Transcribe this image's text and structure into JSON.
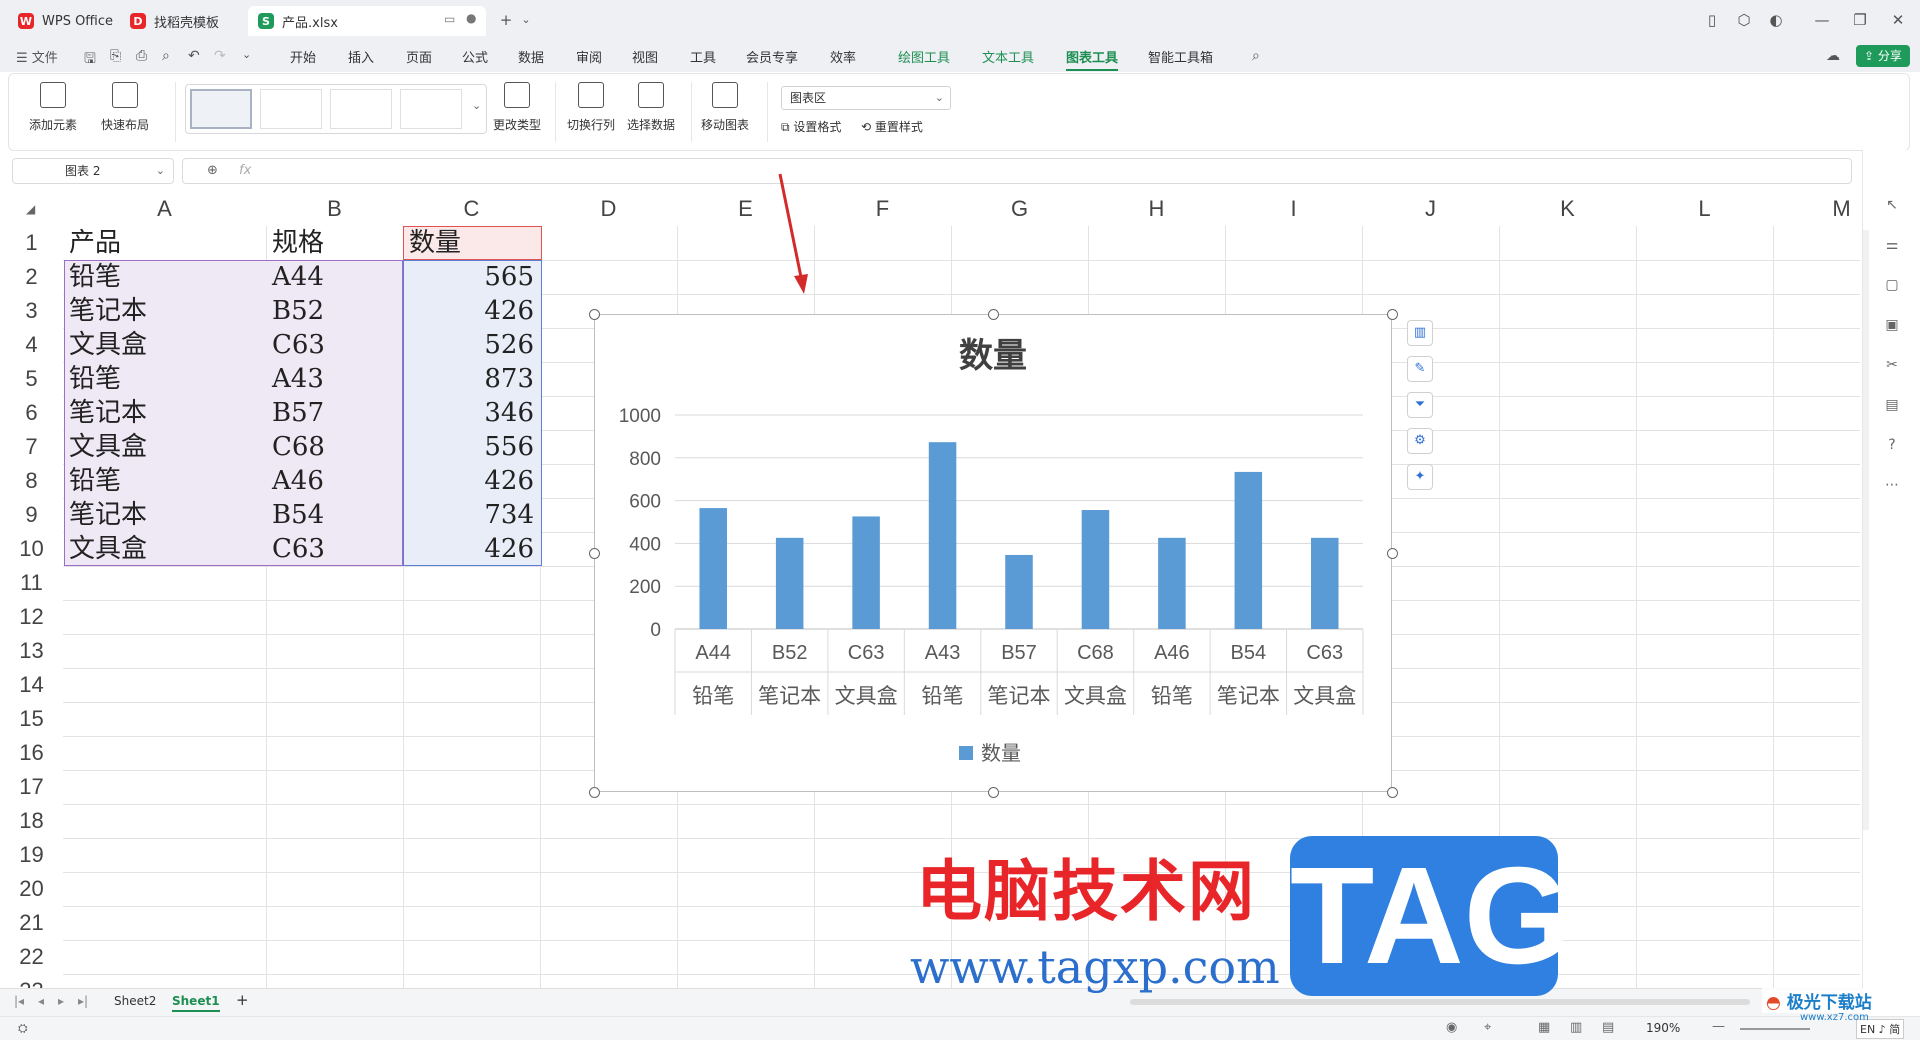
{
  "titlebar": {
    "tabs": [
      {
        "label": "WPS Office",
        "icon": "wps-logo-icon",
        "color": "#e8262a"
      },
      {
        "label": "找稻壳模板",
        "icon": "docer-logo-icon",
        "color": "#e8262a"
      },
      {
        "label": "产品.xlsx",
        "icon": "spreadsheet-icon",
        "color": "#1e9b5a"
      }
    ]
  },
  "menubar": {
    "file": "文件",
    "items": [
      "开始",
      "插入",
      "页面",
      "公式",
      "数据",
      "审阅",
      "视图",
      "工具",
      "会员专享",
      "效率"
    ],
    "tool_items": [
      "绘图工具",
      "文本工具",
      "图表工具",
      "智能工具箱"
    ],
    "active": "图表工具",
    "share": "分享"
  },
  "ribbon": {
    "add_element": "添加元素",
    "quick_layout": "快速布局",
    "change_type": "更改类型",
    "switch_row_col": "切换行列",
    "select_data": "选择数据",
    "move_chart": "移动图表",
    "chart_area_select": "图表区",
    "set_format": "设置格式",
    "reset_style": "重置样式"
  },
  "formula_bar": {
    "name_box": "图表 2",
    "fx": "fx"
  },
  "grid": {
    "columns": [
      "A",
      "B",
      "C",
      "D",
      "E",
      "F",
      "G",
      "H",
      "I",
      "J",
      "K",
      "L",
      "M"
    ],
    "rows": [
      "1",
      "2",
      "3",
      "4",
      "5",
      "6",
      "7",
      "8",
      "9",
      "10",
      "11",
      "12",
      "13",
      "14",
      "15",
      "16",
      "17",
      "18",
      "19",
      "20",
      "21",
      "22",
      "23"
    ],
    "header": [
      "产品",
      "规格",
      "数量"
    ],
    "data": [
      [
        "铅笔",
        "A44",
        "565"
      ],
      [
        "笔记本",
        "B52",
        "426"
      ],
      [
        "文具盒",
        "C63",
        "526"
      ],
      [
        "铅笔",
        "A43",
        "873"
      ],
      [
        "笔记本",
        "B57",
        "346"
      ],
      [
        "文具盒",
        "C68",
        "556"
      ],
      [
        "铅笔",
        "A46",
        "426"
      ],
      [
        "笔记本",
        "B54",
        "734"
      ],
      [
        "文具盒",
        "C63",
        "426"
      ]
    ]
  },
  "chart_data": {
    "type": "bar",
    "title": "数量",
    "categories": [
      "A44",
      "B52",
      "C63",
      "A43",
      "B57",
      "C68",
      "A46",
      "B54",
      "C63"
    ],
    "category_groups": [
      "铅笔",
      "笔记本",
      "文具盒",
      "铅笔",
      "笔记本",
      "文具盒",
      "铅笔",
      "笔记本",
      "文具盒"
    ],
    "series": [
      {
        "name": "数量",
        "values": [
          565,
          426,
          526,
          873,
          346,
          556,
          426,
          734,
          426
        ],
        "color": "#5b9bd5"
      }
    ],
    "yticks": [
      "0",
      "200",
      "400",
      "600",
      "800",
      "1000"
    ],
    "ylim": [
      0,
      1000
    ],
    "grid": true,
    "legend": "bottom"
  },
  "sheets": {
    "tabs": [
      "Sheet2",
      "Sheet1"
    ],
    "active": "Sheet1",
    "add": "+"
  },
  "status": {
    "zoom": "190%",
    "ime": "EN ♪ 简"
  },
  "watermark": {
    "cn": "电脑技术网",
    "url": "www.tagxp.com",
    "tag": "TAG",
    "corner": "极光下载站",
    "corner_url": "www.xz7.com"
  }
}
